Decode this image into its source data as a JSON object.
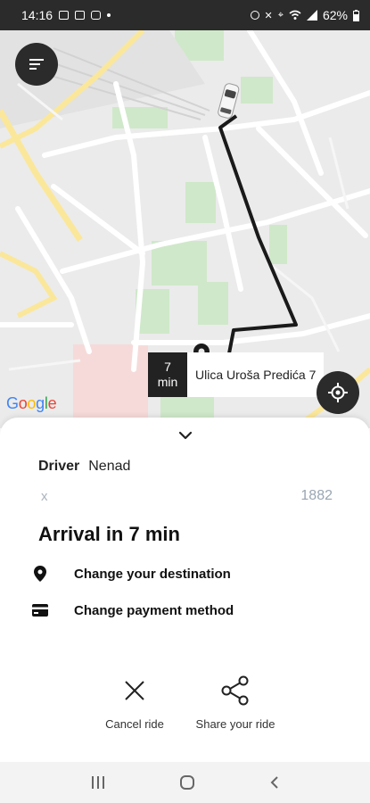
{
  "statusbar": {
    "time": "14:16",
    "battery": "62%",
    "left_icons": [
      "image-icon",
      "message-icon",
      "cast-icon"
    ],
    "right_icons": [
      "alarm-icon",
      "mute-icon",
      "location-icon",
      "wifi-icon",
      "signal-icon",
      "battery-icon"
    ]
  },
  "map": {
    "eta_value": "7",
    "eta_unit": "min",
    "address": "Ulica Uroša Predića 7",
    "attribution": "Google",
    "route_color": "#1a1a1a"
  },
  "sheet": {
    "driver_label": "Driver",
    "driver_name": "Nenad",
    "plate_prefix": "x",
    "plate_number": "1882",
    "arrival_text": "Arrival in 7 min",
    "actions": [
      {
        "icon": "location-pin-icon",
        "label": "Change your destination"
      },
      {
        "icon": "credit-card-icon",
        "label": "Change payment method"
      }
    ],
    "cancel_label": "Cancel ride",
    "share_label": "Share your ride"
  },
  "colors": {
    "dark": "#2b2b2b",
    "accent_muted": "#9aa6b2"
  }
}
